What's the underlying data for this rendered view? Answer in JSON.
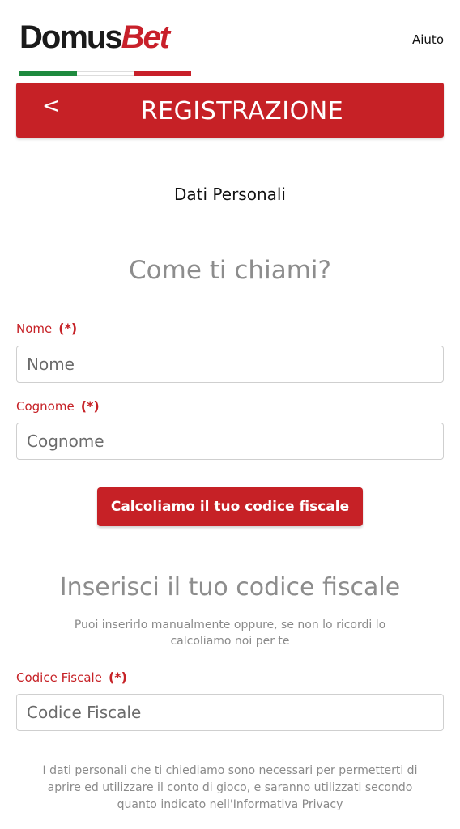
{
  "header": {
    "logo": {
      "part1": "Domus",
      "part2": "Bet"
    },
    "help_label": "Aiuto"
  },
  "title_bar": {
    "back_label": "<",
    "title": "REGISTRAZIONE"
  },
  "step_title": "Dati Personali",
  "name_section": {
    "heading": "Come ti chiami?",
    "first_name": {
      "label": "Nome",
      "required": "(*)",
      "placeholder": "Nome",
      "value": ""
    },
    "last_name": {
      "label": "Cognome",
      "required": "(*)",
      "placeholder": "Cognome",
      "value": ""
    },
    "calc_button": "Calcoliamo il tuo codice fiscale"
  },
  "tax_section": {
    "heading": "Inserisci il tuo codice fiscale",
    "helper": "Puoi inserirlo manualmente oppure, se non lo ricordi lo calcoliamo noi per te",
    "tax_code": {
      "label": "Codice Fiscale",
      "required": "(*)",
      "placeholder": "Codice Fiscale",
      "value": ""
    }
  },
  "privacy_notice": "I dati personali che ti chiediamo sono necessari per permetterti di aprire ed utilizzare il conto di gioco, e saranno utilizzati secondo quanto indicato nell'Informativa Privacy",
  "colors": {
    "brand_red": "#c62126",
    "flag_green": "#1e8a3e",
    "flag_white": "#ffffff",
    "flag_red": "#c8202a",
    "heading_gray": "#8d8d8d"
  }
}
